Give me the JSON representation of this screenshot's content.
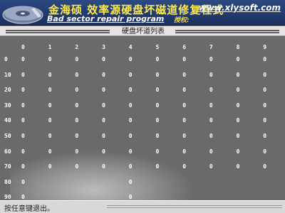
{
  "header": {
    "title_cn": "金海硕 效率源硬盘坏磁道修复程式",
    "title_en": "Bad sector repair program",
    "website": "www.xlysoft.com",
    "auth_label": "授权:",
    "auth_value": ""
  },
  "list": {
    "title": "硬盘坏道列表",
    "columns": [
      "0",
      "1",
      "2",
      "3",
      "4",
      "5",
      "6",
      "7",
      "8",
      "9"
    ],
    "rows": [
      {
        "label": "0",
        "values": [
          "0",
          "0",
          "0",
          "0",
          "0",
          "0",
          "0",
          "0",
          "0",
          "0"
        ]
      },
      {
        "label": "10",
        "values": [
          "0",
          "0",
          "0",
          "0",
          "0",
          "0",
          "0",
          "0",
          "0",
          "0"
        ]
      },
      {
        "label": "20",
        "values": [
          "0",
          "0",
          "0",
          "0",
          "0",
          "0",
          "0",
          "0",
          "0",
          "0"
        ]
      },
      {
        "label": "30",
        "values": [
          "0",
          "0",
          "0",
          "0",
          "0",
          "0",
          "0",
          "0",
          "0",
          "0"
        ]
      },
      {
        "label": "40",
        "values": [
          "0",
          "0",
          "0",
          "0",
          "0",
          "0",
          "0",
          "0",
          "0",
          "0"
        ]
      },
      {
        "label": "50",
        "values": [
          "0",
          "0",
          "0",
          "0",
          "0",
          "0",
          "0",
          "0",
          "0",
          "0"
        ]
      },
      {
        "label": "60",
        "values": [
          "0",
          "0",
          "0",
          "0",
          "0",
          "0",
          "0",
          "0",
          "0",
          "0"
        ]
      },
      {
        "label": "70",
        "values": [
          "0",
          "0",
          "0",
          "0",
          "0",
          "0",
          "0",
          "0",
          "0",
          "0"
        ]
      },
      {
        "label": "80",
        "values": [
          "0",
          "",
          "",
          "",
          "0",
          "",
          "",
          "",
          "",
          ""
        ]
      },
      {
        "label": "90",
        "values": [
          "0",
          "",
          "",
          "",
          "0",
          "",
          "",
          "",
          "",
          ""
        ]
      }
    ]
  },
  "status": {
    "text": "按任意键退出。"
  },
  "colors": {
    "header_bg": "#223a6e",
    "title_yellow": "#ffe94a",
    "grid_bg": "#6a6a6a",
    "text_white": "#ffffff"
  }
}
